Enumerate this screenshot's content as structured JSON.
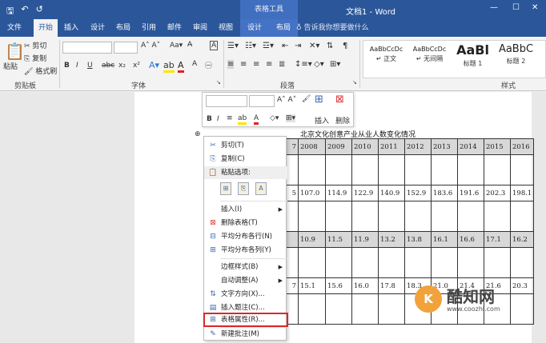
{
  "titlebar": {
    "qat_save": "🖫",
    "qat_undo": "↶",
    "qat_redo": "↺",
    "context_tab_group": "表格工具",
    "document_title": "文档1 - Word"
  },
  "tabs": [
    "文件",
    "开始",
    "插入",
    "设计",
    "布局",
    "引用",
    "邮件",
    "审阅",
    "视图",
    "设计",
    "布局"
  ],
  "tell_me": "告诉我你想要做什么",
  "ribbon": {
    "clipboard": {
      "paste": "粘贴",
      "cut": "剪切",
      "copy": "复制",
      "format_painter": "格式刷",
      "label": "剪贴板"
    },
    "font": {
      "label": "字体",
      "buttons": [
        "B",
        "I",
        "U",
        "abc",
        "x₂",
        "x²"
      ]
    },
    "paragraph": {
      "label": "段落"
    },
    "styles": {
      "label": "样式",
      "items": [
        {
          "sample": "AaBbCcDc",
          "name": "正文"
        },
        {
          "sample": "AaBbCcDc",
          "name": "无间隔"
        },
        {
          "sample": "AaBl",
          "name": "标题 1"
        },
        {
          "sample": "AaBbC",
          "name": "标题 2"
        }
      ]
    }
  },
  "mini_toolbar": {
    "insert": "插入",
    "delete": "删除"
  },
  "document": {
    "table_title": "北京文化创意产业从业人数变化情况",
    "header_years": [
      "7",
      "2008",
      "2009",
      "2010",
      "2011",
      "2012",
      "2013",
      "2014",
      "2015",
      "2016"
    ],
    "row1": [
      "5",
      "107.0",
      "114.9",
      "122.9",
      "140.9",
      "152.9",
      "183.6",
      "191.6",
      "202.3",
      "198.1"
    ],
    "row2": [
      "",
      "10.9",
      "11.5",
      "11.9",
      "13.2",
      "13.8",
      "16.1",
      "16.6",
      "17.1",
      "16.2"
    ],
    "row3": [
      "7",
      "15.1",
      "15.6",
      "16.0",
      "17.8",
      "18.3",
      "21.0",
      "21.4",
      "21.6",
      "20.3"
    ]
  },
  "context_menu": {
    "cut": "剪切(T)",
    "copy": "复制(C)",
    "paste_options": "粘贴选项:",
    "insert": "插入(I)",
    "delete_table": "删除表格(T)",
    "distribute_rows": "平均分布各行(N)",
    "distribute_cols": "平均分布各列(Y)",
    "border_styles": "边框样式(B)",
    "autofit": "自动调整(A)",
    "text_direction": "文字方向(X)...",
    "insert_caption": "插入题注(C)...",
    "table_properties": "表格属性(R)...",
    "new_comment": "新建批注(M)"
  },
  "watermark": {
    "name": "酷知网",
    "url": "www.coozhi.com"
  },
  "colors": {
    "word_blue": "#2b579a",
    "highlight_red": "#d9282b"
  }
}
